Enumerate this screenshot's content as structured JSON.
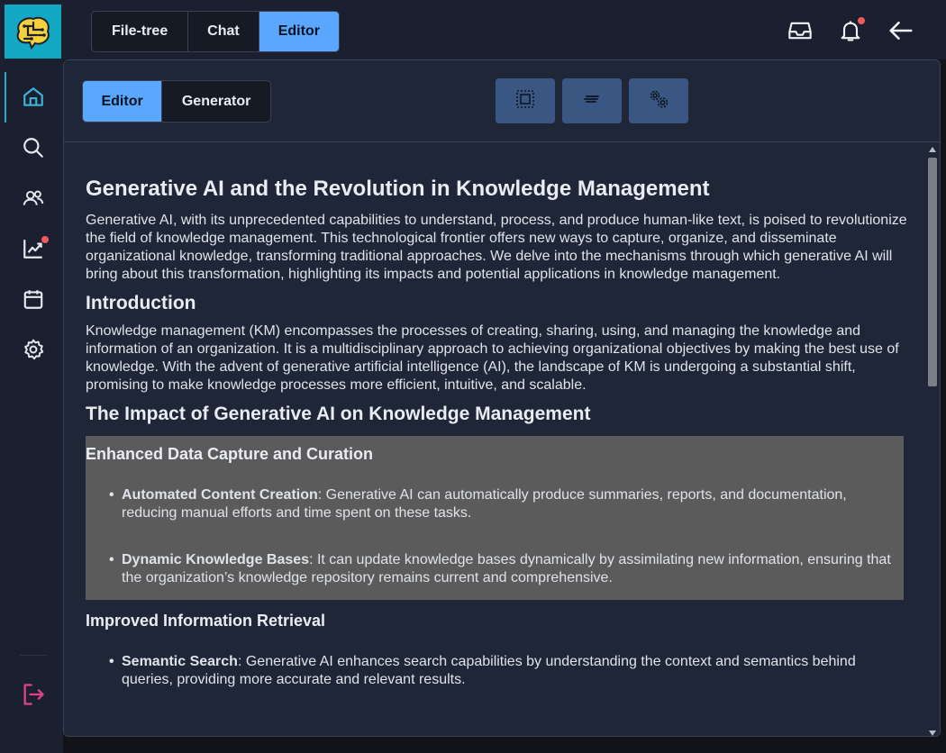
{
  "topbar": {
    "tabs": [
      {
        "label": "File-tree",
        "active": false
      },
      {
        "label": "Chat",
        "active": false
      },
      {
        "label": "Editor",
        "active": true
      }
    ],
    "icons": [
      "inbox-icon",
      "bell-icon",
      "back-arrow-icon"
    ]
  },
  "sidebar": {
    "items": [
      "home-icon",
      "search-icon",
      "users-icon",
      "analytics-icon",
      "calendar-icon",
      "settings-icon"
    ],
    "logout": "logout-icon"
  },
  "panel": {
    "mode_tabs": [
      {
        "label": "Editor",
        "active": true
      },
      {
        "label": "Generator",
        "active": false
      }
    ],
    "tools": [
      "select-frame-icon",
      "align-text-icon",
      "settings-gears-icon"
    ]
  },
  "document": {
    "title": "Generative AI and the Revolution in Knowledge Management",
    "intro": "Generative AI, with its unprecedented capabilities to understand, process, and produce human-like text, is poised to revolutionize the field of knowledge management. This technological frontier offers new ways to capture, organize, and disseminate organizational knowledge, transforming traditional approaches. We delve into the mechanisms through which generative AI will bring about this transformation, highlighting its impacts and potential applications in knowledge management.",
    "section1_heading": "Introduction",
    "section1_text": "Knowledge management (KM) encompasses the processes of creating, sharing, using, and managing the knowledge and information of an organization. It is a multidisciplinary approach to achieving organizational objectives by making the best use of knowledge. With the advent of generative artificial intelligence (AI), the landscape of KM is undergoing a substantial shift, promising to make knowledge processes more efficient, intuitive, and scalable.",
    "section2_heading": "The Impact of Generative AI on Knowledge Management",
    "sub1_heading": "Enhanced Data Capture and Curation",
    "sub1_items": [
      {
        "term": "Automated Content Creation",
        "text": ": Generative AI can automatically produce summaries, reports, and documentation, reducing manual efforts and time spent on these tasks."
      },
      {
        "term": "Dynamic Knowledge Bases",
        "text": ": It can update knowledge bases dynamically by assimilating new information, ensuring that the organization’s knowledge repository remains current and comprehensive."
      }
    ],
    "sub2_heading": "Improved Information Retrieval",
    "sub2_items": [
      {
        "term": "Semantic Search",
        "text": ": Generative AI enhances search capabilities by understanding the context and semantics behind queries, providing more accurate and relevant results."
      }
    ]
  },
  "colors": {
    "accent": "#5aa7ff",
    "logo_bg": "#13a8c4",
    "notification_dot": "#f05a5a",
    "logout": "#e0418a",
    "highlight_block": "#5b5b5b"
  }
}
